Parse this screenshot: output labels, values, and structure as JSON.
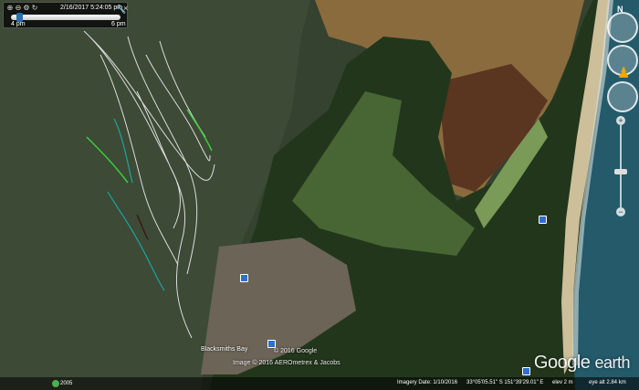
{
  "slider": {
    "date_time": "2/16/2017   5:24:05 pm",
    "start_label": "4 pm",
    "end_label": "6 pm",
    "position": 0.05
  },
  "map": {
    "copyright_1": "© 2016 Google",
    "copyright_2": "Image © 2016 AEROmetrex & Jacobs",
    "place_label": "Blacksmiths Bay",
    "logo_word1": "Google",
    "logo_word2": "earth"
  },
  "status": {
    "history_year": "2005",
    "imagery_date": "Imagery Date: 1/10/2016",
    "coordinates": "33°05'05.51\" S  151°39'29.01\" E",
    "elevation": "elev   2 m",
    "eye_alt": "eye alt   2.84 km"
  },
  "colors": {
    "track_white": "#dcdcdc",
    "track_green": "#3ccc3c",
    "track_teal": "#1ba5a0",
    "track_dark": "#3b1a12"
  }
}
